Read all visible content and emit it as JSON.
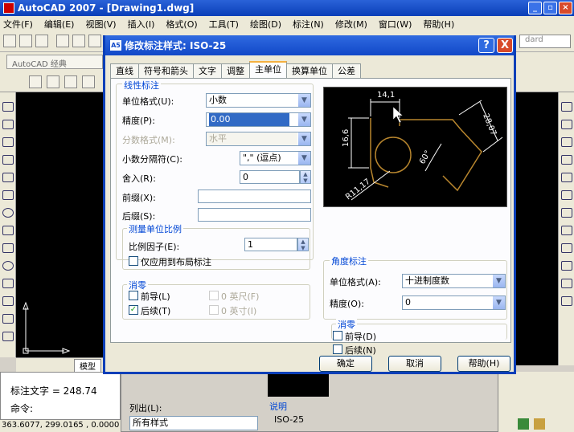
{
  "app": {
    "title": "AutoCAD 2007 - [Drawing1.dwg]",
    "menu": [
      "文件(F)",
      "编辑(E)",
      "视图(V)",
      "插入(I)",
      "格式(O)",
      "工具(T)",
      "绘图(D)",
      "标注(N)",
      "修改(M)",
      "窗口(W)",
      "帮助(H)"
    ],
    "workspace": "AutoCAD 经典",
    "standard_label": "dard",
    "model_tab": "模型",
    "cmd_line1": "标注文字 = 248.74",
    "cmd_line2": "命令:",
    "status_coords": "363.6077, 299.0165 , 0.0000",
    "behind": {
      "list_label": "列出(L):",
      "list_value": "所有样式",
      "desc_label": "说明",
      "desc_value": "ISO-25"
    }
  },
  "dialog": {
    "title": "修改标注样式: ISO-25",
    "help_symbol": "?",
    "close_symbol": "X",
    "tabs": [
      "直线",
      "符号和箭头",
      "文字",
      "调整",
      "主单位",
      "换算单位",
      "公差"
    ],
    "active_tab": 4,
    "linear": {
      "group_label": "线性标注",
      "unit_format_label": "单位格式(U):",
      "unit_format_value": "小数",
      "precision_label": "精度(P):",
      "precision_value": "0.00",
      "fraction_label": "分数格式(M):",
      "fraction_value": "水平",
      "decimal_sep_label": "小数分隔符(C):",
      "decimal_sep_value": "\",\"  (逗点)",
      "round_label": "舍入(R):",
      "round_value": "0",
      "prefix_label": "前缀(X):",
      "suffix_label": "后缀(S):"
    },
    "scale": {
      "group_label": "测量单位比例",
      "factor_label": "比例因子(E):",
      "factor_value": "1",
      "layout_only_label": "仅应用到布局标注"
    },
    "zero_left": {
      "group_label": "消零",
      "leading_label": "前导(L)",
      "trailing_label": "后续(T)",
      "feet_label": "0 英尺(F)",
      "inches_label": "0 英寸(I)",
      "leading_checked": false,
      "trailing_checked": true
    },
    "angular": {
      "group_label": "角度标注",
      "unit_format_label": "单位格式(A):",
      "unit_format_value": "十进制度数",
      "precision_label": "精度(O):",
      "precision_value": "0"
    },
    "zero_right": {
      "group_label": "消零",
      "leading_label": "前导(D)",
      "trailing_label": "后续(N)"
    },
    "preview": {
      "dim_top": "14,1",
      "dim_left": "16,6",
      "dim_right": "28,07",
      "dim_angle": "60°",
      "dim_radius": "R11,17"
    },
    "buttons": {
      "ok": "确定",
      "cancel": "取消",
      "help": "帮助(H)"
    }
  }
}
